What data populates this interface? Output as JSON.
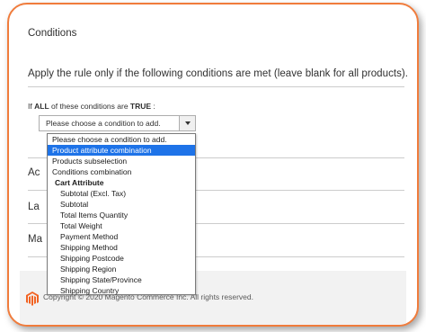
{
  "section": {
    "title": "Conditions"
  },
  "rule": {
    "heading": "Apply the rule only if the following conditions are met (leave blank for all products)."
  },
  "if_line": {
    "prefix": "If",
    "aggregator": "ALL",
    "middle": "of these conditions are",
    "value": "TRUE",
    "suffix": ":"
  },
  "select": {
    "value": "Please choose a condition to add."
  },
  "collapsed_sections": [
    "Ac",
    "La",
    "Ma"
  ],
  "footer": {
    "copyright": "Copyright © 2020 Magento Commerce Inc. All rights reserved."
  },
  "dropdown": {
    "options": [
      {
        "label": "Please choose a condition to add.",
        "kind": "plain"
      },
      {
        "label": "Product attribute combination",
        "kind": "selected"
      },
      {
        "label": "Products subselection",
        "kind": "plain"
      },
      {
        "label": "Conditions combination",
        "kind": "plain"
      },
      {
        "label": "Cart Attribute",
        "kind": "group"
      },
      {
        "label": "Subtotal (Excl. Tax)",
        "kind": "sub"
      },
      {
        "label": "Subtotal",
        "kind": "sub"
      },
      {
        "label": "Total Items Quantity",
        "kind": "sub"
      },
      {
        "label": "Total Weight",
        "kind": "sub"
      },
      {
        "label": "Payment Method",
        "kind": "sub"
      },
      {
        "label": "Shipping Method",
        "kind": "sub"
      },
      {
        "label": "Shipping Postcode",
        "kind": "sub"
      },
      {
        "label": "Shipping Region",
        "kind": "sub"
      },
      {
        "label": "Shipping State/Province",
        "kind": "sub"
      },
      {
        "label": "Shipping Country",
        "kind": "sub"
      }
    ]
  },
  "colors": {
    "accent_border": "#f07c3c",
    "selection": "#1e73e8",
    "logo": "#f26322"
  },
  "icons": {
    "logo": "magento-logo-icon",
    "select_arrow": "chevron-down-icon"
  }
}
